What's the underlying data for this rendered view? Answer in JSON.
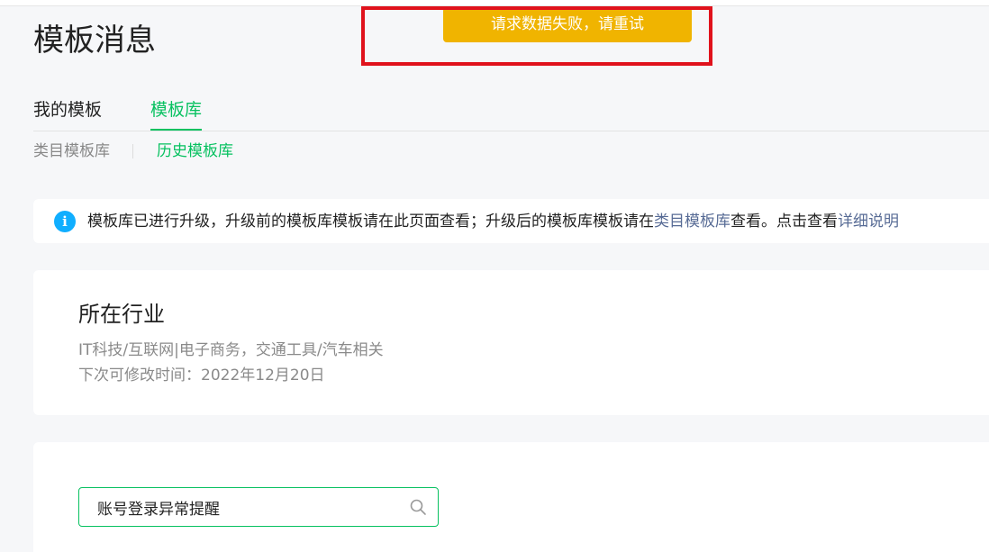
{
  "page": {
    "title": "模板消息"
  },
  "toast": {
    "message": "请求数据失败，请重试"
  },
  "main_tabs": [
    {
      "label": "我的模板",
      "active": false
    },
    {
      "label": "模板库",
      "active": true
    }
  ],
  "sub_tabs": [
    {
      "label": "类目模板库",
      "active": false
    },
    {
      "label": "历史模板库",
      "active": true
    }
  ],
  "notice": {
    "icon": "info-icon",
    "text_before": "模板库已进行升级，升级前的模板库模板请在此页面查看；升级后的模板库模板请在",
    "link1": "类目模板库",
    "text_middle": "查看。点击查看",
    "link2": "详细说明"
  },
  "industry": {
    "title": "所在行业",
    "value": "IT科技/互联网|电子商务，交通工具/汽车相关",
    "next_modify": "下次可修改时间：2022年12月20日"
  },
  "search": {
    "value": "账号登录异常提醒",
    "icon": "search-icon"
  },
  "colors": {
    "accent": "#07c160",
    "toast_bg": "#f0b400",
    "highlight_border": "#e0121c",
    "info_icon": "#10aeff",
    "link": "#576b95"
  }
}
